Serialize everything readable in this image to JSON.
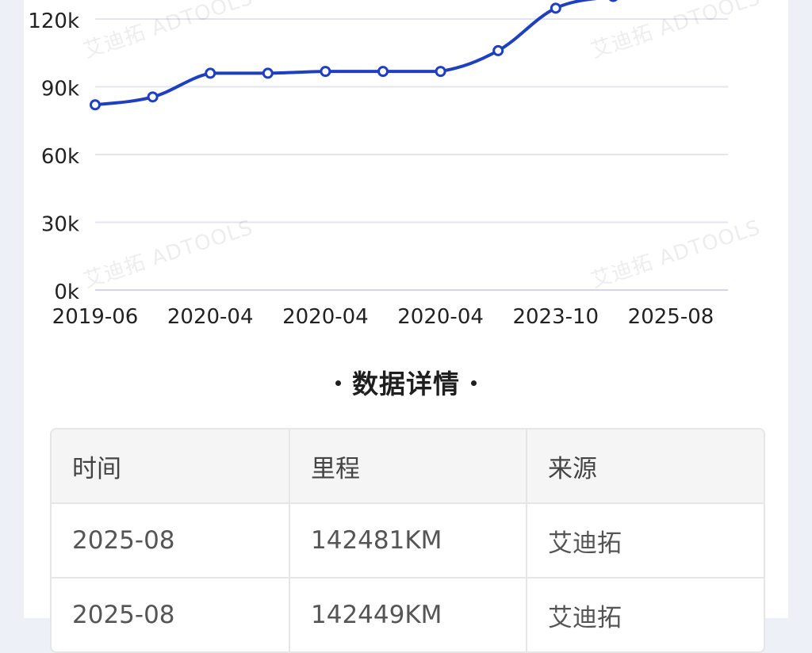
{
  "chart_data": {
    "type": "line",
    "x_tick_labels": [
      "2019-06",
      "2020-04",
      "2020-04",
      "2020-04",
      "2023-10",
      "2025-08"
    ],
    "y_tick_labels": [
      "0k",
      "30k",
      "60k",
      "90k",
      "120k"
    ],
    "ylim": [
      0,
      120000
    ],
    "grid": true,
    "series": [
      {
        "values": [
          82000,
          85500,
          96000,
          96000,
          96800,
          96800,
          96800,
          106000,
          124800,
          130000
        ]
      }
    ],
    "color": "#1e3fc2"
  },
  "details": {
    "title": "数据详情",
    "columns": [
      "时间",
      "里程",
      "来源"
    ],
    "rows": [
      [
        "2025-08",
        "142481KM",
        "艾迪拓"
      ],
      [
        "2025-08",
        "142449KM",
        "艾迪拓"
      ]
    ]
  },
  "watermark": "艾迪拓 ADTOOLS"
}
